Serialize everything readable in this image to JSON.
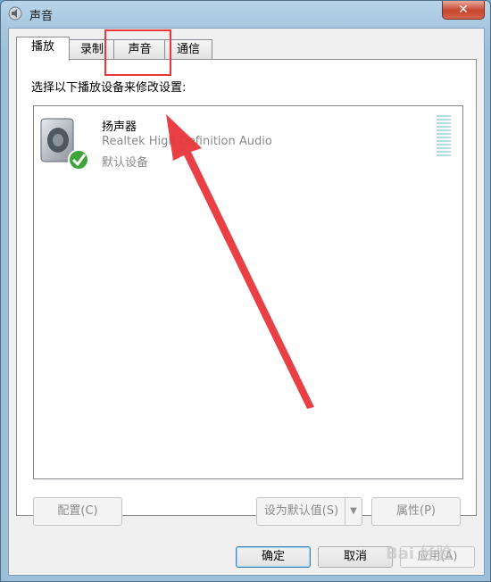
{
  "window": {
    "title": "声音",
    "close_label": "✕"
  },
  "tabs": [
    {
      "label": "播放",
      "active": true
    },
    {
      "label": "录制",
      "active": false
    },
    {
      "label": "声音",
      "active": false
    },
    {
      "label": "通信",
      "active": false
    }
  ],
  "panel": {
    "instruction": "选择以下播放设备来修改设置:",
    "devices": [
      {
        "name": "扬声器",
        "description": "Realtek High Definition Audio",
        "status": "默认设备",
        "icon": "speaker-icon",
        "default_badge": "green-check-icon"
      }
    ],
    "buttons": {
      "configure": "配置(C)",
      "set_default": "设为默认值(S)",
      "properties": "属性(P)"
    }
  },
  "footer": {
    "ok": "确定",
    "cancel": "取消",
    "apply": "应用(A)"
  },
  "annotation": {
    "highlight_color": "#e8363b",
    "arrow_color": "#e8363b"
  },
  "watermark_text": "Bai 经验"
}
